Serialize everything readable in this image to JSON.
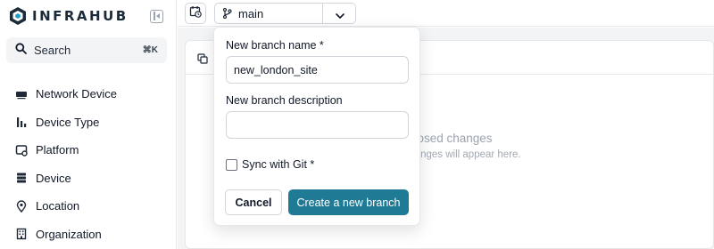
{
  "brand": {
    "name": "INFRAHUB",
    "logo_icon": "infrahub-hexagon-logo"
  },
  "sidebar": {
    "collapse_icon": "sidebar-collapse-icon",
    "search": {
      "label": "Search",
      "shortcut": "⌘K",
      "icon": "search-icon"
    },
    "items": [
      {
        "label": "Network Device",
        "icon": "network-device-icon"
      },
      {
        "label": "Device Type",
        "icon": "bar-chart-icon"
      },
      {
        "label": "Platform",
        "icon": "platform-icon"
      },
      {
        "label": "Device",
        "icon": "server-icon"
      },
      {
        "label": "Location",
        "icon": "location-pin-icon"
      },
      {
        "label": "Organization",
        "icon": "building-icon"
      }
    ]
  },
  "topbar": {
    "calendar_icon": "calendar-clock-icon",
    "branch": {
      "name": "main",
      "icon": "git-branch-icon",
      "caret_icon": "chevron-down-icon"
    }
  },
  "main": {
    "empty_state": {
      "title": "You don't have any open proposed changes",
      "subtitle": "Once you create or review a branch, changes will appear here."
    }
  },
  "branch_form": {
    "name_label": "New branch name *",
    "name_value": "new_london_site",
    "description_label": "New branch description",
    "description_value": "",
    "sync_label": "Sync with Git *",
    "sync_checked": false,
    "cancel_label": "Cancel",
    "create_label": "Create a new branch"
  },
  "colors": {
    "accent": "#1f7a96",
    "brand_dark": "#1c2b3a"
  }
}
